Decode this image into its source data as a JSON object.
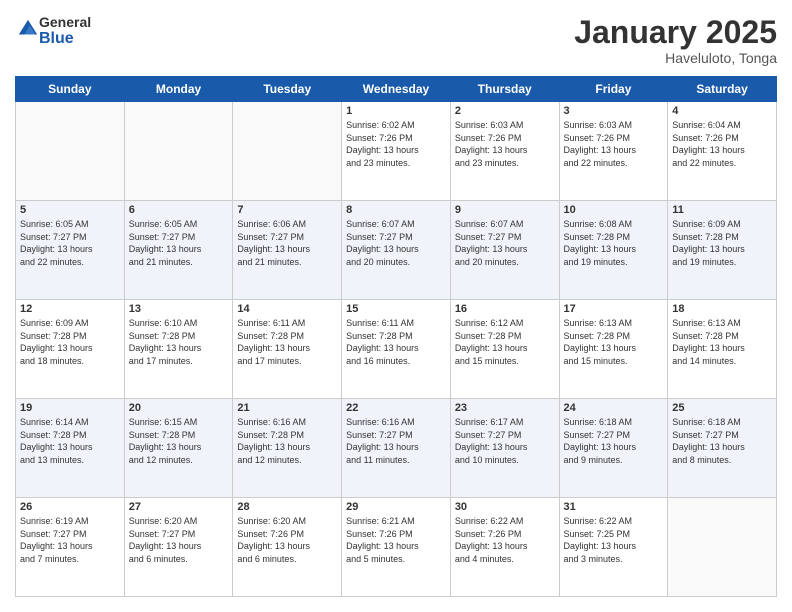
{
  "header": {
    "logo_general": "General",
    "logo_blue": "Blue",
    "month_title": "January 2025",
    "location": "Haveluloto, Tonga"
  },
  "days_of_week": [
    "Sunday",
    "Monday",
    "Tuesday",
    "Wednesday",
    "Thursday",
    "Friday",
    "Saturday"
  ],
  "weeks": [
    [
      {
        "day": "",
        "info": ""
      },
      {
        "day": "",
        "info": ""
      },
      {
        "day": "",
        "info": ""
      },
      {
        "day": "1",
        "info": "Sunrise: 6:02 AM\nSunset: 7:26 PM\nDaylight: 13 hours\nand 23 minutes."
      },
      {
        "day": "2",
        "info": "Sunrise: 6:03 AM\nSunset: 7:26 PM\nDaylight: 13 hours\nand 23 minutes."
      },
      {
        "day": "3",
        "info": "Sunrise: 6:03 AM\nSunset: 7:26 PM\nDaylight: 13 hours\nand 22 minutes."
      },
      {
        "day": "4",
        "info": "Sunrise: 6:04 AM\nSunset: 7:26 PM\nDaylight: 13 hours\nand 22 minutes."
      }
    ],
    [
      {
        "day": "5",
        "info": "Sunrise: 6:05 AM\nSunset: 7:27 PM\nDaylight: 13 hours\nand 22 minutes."
      },
      {
        "day": "6",
        "info": "Sunrise: 6:05 AM\nSunset: 7:27 PM\nDaylight: 13 hours\nand 21 minutes."
      },
      {
        "day": "7",
        "info": "Sunrise: 6:06 AM\nSunset: 7:27 PM\nDaylight: 13 hours\nand 21 minutes."
      },
      {
        "day": "8",
        "info": "Sunrise: 6:07 AM\nSunset: 7:27 PM\nDaylight: 13 hours\nand 20 minutes."
      },
      {
        "day": "9",
        "info": "Sunrise: 6:07 AM\nSunset: 7:27 PM\nDaylight: 13 hours\nand 20 minutes."
      },
      {
        "day": "10",
        "info": "Sunrise: 6:08 AM\nSunset: 7:28 PM\nDaylight: 13 hours\nand 19 minutes."
      },
      {
        "day": "11",
        "info": "Sunrise: 6:09 AM\nSunset: 7:28 PM\nDaylight: 13 hours\nand 19 minutes."
      }
    ],
    [
      {
        "day": "12",
        "info": "Sunrise: 6:09 AM\nSunset: 7:28 PM\nDaylight: 13 hours\nand 18 minutes."
      },
      {
        "day": "13",
        "info": "Sunrise: 6:10 AM\nSunset: 7:28 PM\nDaylight: 13 hours\nand 17 minutes."
      },
      {
        "day": "14",
        "info": "Sunrise: 6:11 AM\nSunset: 7:28 PM\nDaylight: 13 hours\nand 17 minutes."
      },
      {
        "day": "15",
        "info": "Sunrise: 6:11 AM\nSunset: 7:28 PM\nDaylight: 13 hours\nand 16 minutes."
      },
      {
        "day": "16",
        "info": "Sunrise: 6:12 AM\nSunset: 7:28 PM\nDaylight: 13 hours\nand 15 minutes."
      },
      {
        "day": "17",
        "info": "Sunrise: 6:13 AM\nSunset: 7:28 PM\nDaylight: 13 hours\nand 15 minutes."
      },
      {
        "day": "18",
        "info": "Sunrise: 6:13 AM\nSunset: 7:28 PM\nDaylight: 13 hours\nand 14 minutes."
      }
    ],
    [
      {
        "day": "19",
        "info": "Sunrise: 6:14 AM\nSunset: 7:28 PM\nDaylight: 13 hours\nand 13 minutes."
      },
      {
        "day": "20",
        "info": "Sunrise: 6:15 AM\nSunset: 7:28 PM\nDaylight: 13 hours\nand 12 minutes."
      },
      {
        "day": "21",
        "info": "Sunrise: 6:16 AM\nSunset: 7:28 PM\nDaylight: 13 hours\nand 12 minutes."
      },
      {
        "day": "22",
        "info": "Sunrise: 6:16 AM\nSunset: 7:27 PM\nDaylight: 13 hours\nand 11 minutes."
      },
      {
        "day": "23",
        "info": "Sunrise: 6:17 AM\nSunset: 7:27 PM\nDaylight: 13 hours\nand 10 minutes."
      },
      {
        "day": "24",
        "info": "Sunrise: 6:18 AM\nSunset: 7:27 PM\nDaylight: 13 hours\nand 9 minutes."
      },
      {
        "day": "25",
        "info": "Sunrise: 6:18 AM\nSunset: 7:27 PM\nDaylight: 13 hours\nand 8 minutes."
      }
    ],
    [
      {
        "day": "26",
        "info": "Sunrise: 6:19 AM\nSunset: 7:27 PM\nDaylight: 13 hours\nand 7 minutes."
      },
      {
        "day": "27",
        "info": "Sunrise: 6:20 AM\nSunset: 7:27 PM\nDaylight: 13 hours\nand 6 minutes."
      },
      {
        "day": "28",
        "info": "Sunrise: 6:20 AM\nSunset: 7:26 PM\nDaylight: 13 hours\nand 6 minutes."
      },
      {
        "day": "29",
        "info": "Sunrise: 6:21 AM\nSunset: 7:26 PM\nDaylight: 13 hours\nand 5 minutes."
      },
      {
        "day": "30",
        "info": "Sunrise: 6:22 AM\nSunset: 7:26 PM\nDaylight: 13 hours\nand 4 minutes."
      },
      {
        "day": "31",
        "info": "Sunrise: 6:22 AM\nSunset: 7:25 PM\nDaylight: 13 hours\nand 3 minutes."
      },
      {
        "day": "",
        "info": ""
      }
    ]
  ]
}
